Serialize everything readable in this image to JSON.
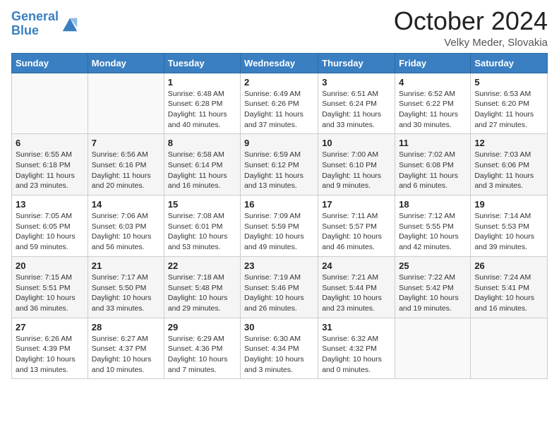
{
  "header": {
    "logo_line1": "General",
    "logo_line2": "Blue",
    "month": "October 2024",
    "location": "Velky Meder, Slovakia"
  },
  "days_of_week": [
    "Sunday",
    "Monday",
    "Tuesday",
    "Wednesday",
    "Thursday",
    "Friday",
    "Saturday"
  ],
  "weeks": [
    [
      {
        "day": "",
        "info": ""
      },
      {
        "day": "",
        "info": ""
      },
      {
        "day": "1",
        "info": "Sunrise: 6:48 AM\nSunset: 6:28 PM\nDaylight: 11 hours and 40 minutes."
      },
      {
        "day": "2",
        "info": "Sunrise: 6:49 AM\nSunset: 6:26 PM\nDaylight: 11 hours and 37 minutes."
      },
      {
        "day": "3",
        "info": "Sunrise: 6:51 AM\nSunset: 6:24 PM\nDaylight: 11 hours and 33 minutes."
      },
      {
        "day": "4",
        "info": "Sunrise: 6:52 AM\nSunset: 6:22 PM\nDaylight: 11 hours and 30 minutes."
      },
      {
        "day": "5",
        "info": "Sunrise: 6:53 AM\nSunset: 6:20 PM\nDaylight: 11 hours and 27 minutes."
      }
    ],
    [
      {
        "day": "6",
        "info": "Sunrise: 6:55 AM\nSunset: 6:18 PM\nDaylight: 11 hours and 23 minutes."
      },
      {
        "day": "7",
        "info": "Sunrise: 6:56 AM\nSunset: 6:16 PM\nDaylight: 11 hours and 20 minutes."
      },
      {
        "day": "8",
        "info": "Sunrise: 6:58 AM\nSunset: 6:14 PM\nDaylight: 11 hours and 16 minutes."
      },
      {
        "day": "9",
        "info": "Sunrise: 6:59 AM\nSunset: 6:12 PM\nDaylight: 11 hours and 13 minutes."
      },
      {
        "day": "10",
        "info": "Sunrise: 7:00 AM\nSunset: 6:10 PM\nDaylight: 11 hours and 9 minutes."
      },
      {
        "day": "11",
        "info": "Sunrise: 7:02 AM\nSunset: 6:08 PM\nDaylight: 11 hours and 6 minutes."
      },
      {
        "day": "12",
        "info": "Sunrise: 7:03 AM\nSunset: 6:06 PM\nDaylight: 11 hours and 3 minutes."
      }
    ],
    [
      {
        "day": "13",
        "info": "Sunrise: 7:05 AM\nSunset: 6:05 PM\nDaylight: 10 hours and 59 minutes."
      },
      {
        "day": "14",
        "info": "Sunrise: 7:06 AM\nSunset: 6:03 PM\nDaylight: 10 hours and 56 minutes."
      },
      {
        "day": "15",
        "info": "Sunrise: 7:08 AM\nSunset: 6:01 PM\nDaylight: 10 hours and 53 minutes."
      },
      {
        "day": "16",
        "info": "Sunrise: 7:09 AM\nSunset: 5:59 PM\nDaylight: 10 hours and 49 minutes."
      },
      {
        "day": "17",
        "info": "Sunrise: 7:11 AM\nSunset: 5:57 PM\nDaylight: 10 hours and 46 minutes."
      },
      {
        "day": "18",
        "info": "Sunrise: 7:12 AM\nSunset: 5:55 PM\nDaylight: 10 hours and 42 minutes."
      },
      {
        "day": "19",
        "info": "Sunrise: 7:14 AM\nSunset: 5:53 PM\nDaylight: 10 hours and 39 minutes."
      }
    ],
    [
      {
        "day": "20",
        "info": "Sunrise: 7:15 AM\nSunset: 5:51 PM\nDaylight: 10 hours and 36 minutes."
      },
      {
        "day": "21",
        "info": "Sunrise: 7:17 AM\nSunset: 5:50 PM\nDaylight: 10 hours and 33 minutes."
      },
      {
        "day": "22",
        "info": "Sunrise: 7:18 AM\nSunset: 5:48 PM\nDaylight: 10 hours and 29 minutes."
      },
      {
        "day": "23",
        "info": "Sunrise: 7:19 AM\nSunset: 5:46 PM\nDaylight: 10 hours and 26 minutes."
      },
      {
        "day": "24",
        "info": "Sunrise: 7:21 AM\nSunset: 5:44 PM\nDaylight: 10 hours and 23 minutes."
      },
      {
        "day": "25",
        "info": "Sunrise: 7:22 AM\nSunset: 5:42 PM\nDaylight: 10 hours and 19 minutes."
      },
      {
        "day": "26",
        "info": "Sunrise: 7:24 AM\nSunset: 5:41 PM\nDaylight: 10 hours and 16 minutes."
      }
    ],
    [
      {
        "day": "27",
        "info": "Sunrise: 6:26 AM\nSunset: 4:39 PM\nDaylight: 10 hours and 13 minutes."
      },
      {
        "day": "28",
        "info": "Sunrise: 6:27 AM\nSunset: 4:37 PM\nDaylight: 10 hours and 10 minutes."
      },
      {
        "day": "29",
        "info": "Sunrise: 6:29 AM\nSunset: 4:36 PM\nDaylight: 10 hours and 7 minutes."
      },
      {
        "day": "30",
        "info": "Sunrise: 6:30 AM\nSunset: 4:34 PM\nDaylight: 10 hours and 3 minutes."
      },
      {
        "day": "31",
        "info": "Sunrise: 6:32 AM\nSunset: 4:32 PM\nDaylight: 10 hours and 0 minutes."
      },
      {
        "day": "",
        "info": ""
      },
      {
        "day": "",
        "info": ""
      }
    ]
  ]
}
